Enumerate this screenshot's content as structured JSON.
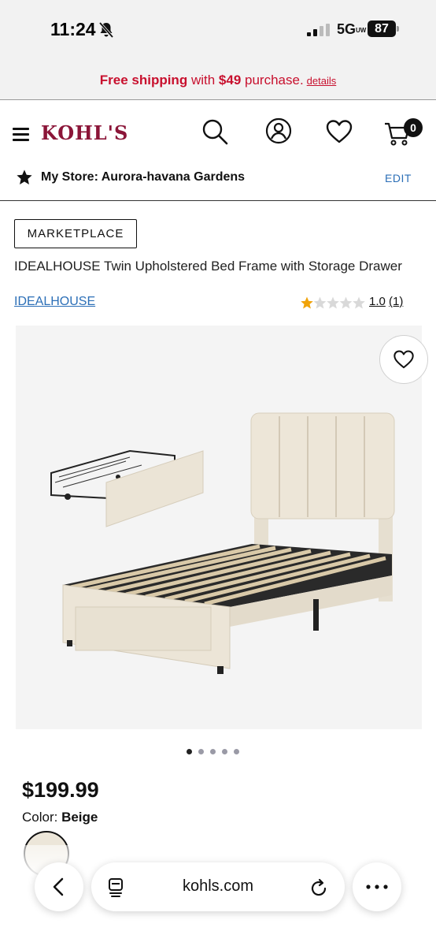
{
  "status": {
    "time": "11:24",
    "network": "5G",
    "network_sub": "UW",
    "battery": "87"
  },
  "promo": {
    "free_shipping": "Free shipping",
    "with": " with ",
    "amount": "$49",
    "purchase": " purchase.",
    "details": "details"
  },
  "header": {
    "logo": "KOHL'S",
    "cart_count": "0"
  },
  "store": {
    "label": "My Store: Aurora-havana Gardens",
    "edit": "EDIT"
  },
  "product": {
    "badge": "MARKETPLACE",
    "title": "IDEALHOUSE Twin Upholstered Bed Frame with Storage Drawer",
    "brand": "IDEALHOUSE",
    "rating": "1.0",
    "review_count": "(1)",
    "rating_stars": 1,
    "price": "$199.99",
    "color_label": "Color: ",
    "color_value": "Beige",
    "image_count": 5,
    "active_image": 1
  },
  "browser": {
    "url": "kohls.com"
  },
  "colors": {
    "brand": "#8b1538",
    "promo": "#c8102e",
    "link": "#2c6fb7",
    "star": "#f0a30a"
  },
  "icons": [
    "bell-slash-icon",
    "signal-icon",
    "hamburger-icon",
    "search-icon",
    "account-icon",
    "heart-icon",
    "cart-icon",
    "star-icon",
    "chevron-left-icon",
    "tabs-icon",
    "reload-icon",
    "more-icon"
  ]
}
